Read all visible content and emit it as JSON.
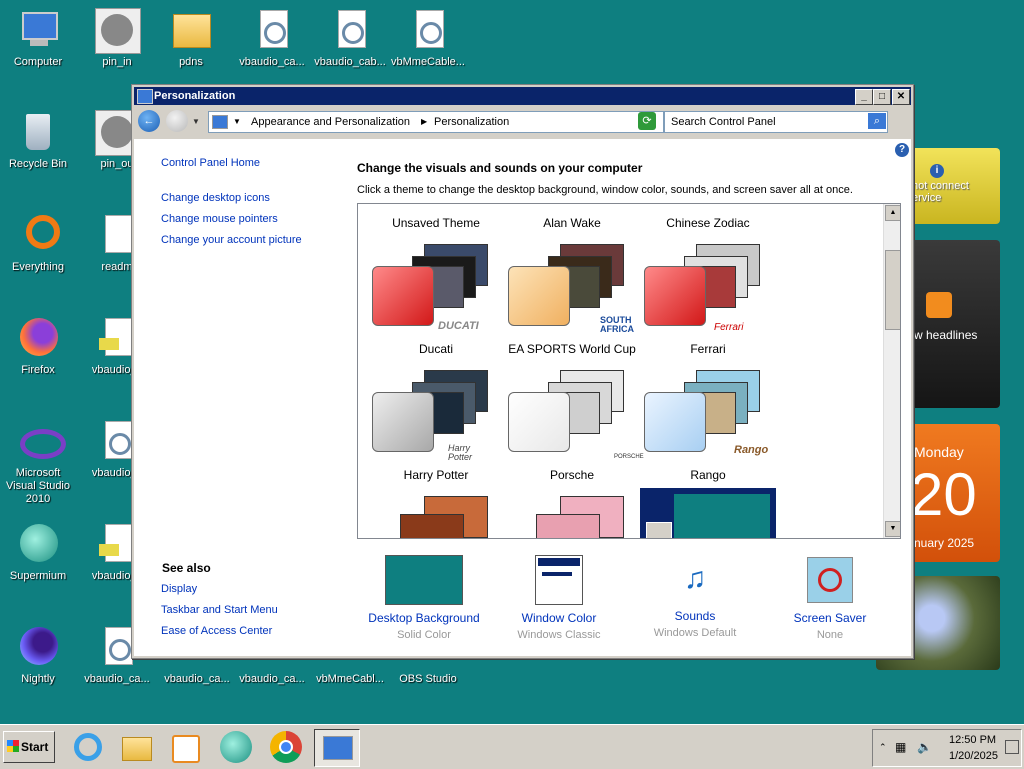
{
  "desktop_icons": [
    {
      "label": "Computer",
      "icon": "computer-icon"
    },
    {
      "label": "pin_in",
      "icon": "film-reel-icon"
    },
    {
      "label": "pdns",
      "icon": "folder-icon"
    },
    {
      "label": "vbaudio_ca...",
      "icon": "config-file-icon"
    },
    {
      "label": "vbaudio_cab...",
      "icon": "config-file-icon"
    },
    {
      "label": "vbMmeCable...",
      "icon": "config-file-icon"
    },
    {
      "label": "Recycle Bin",
      "icon": "recycle-bin-icon"
    },
    {
      "label": "pin_ou",
      "icon": "film-reel-icon"
    },
    {
      "label": "Everything",
      "icon": "everything-search-icon"
    },
    {
      "label": "readm",
      "icon": "text-file-icon"
    },
    {
      "label": "Firefox",
      "icon": "firefox-icon"
    },
    {
      "label": "vbaudio_c",
      "icon": "setup-file-icon"
    },
    {
      "label": "Microsoft Visual Studio 2010",
      "icon": "visual-studio-icon"
    },
    {
      "label": "vbaudio_c",
      "icon": "config-file-icon"
    },
    {
      "label": "Supermium",
      "icon": "supermium-icon"
    },
    {
      "label": "vbaudio_c",
      "icon": "setup-file-icon"
    },
    {
      "label": "Nightly",
      "icon": "firefox-nightly-icon"
    },
    {
      "label": "vbaudio_ca...",
      "icon": "config-file-icon"
    },
    {
      "label": "vbaudio_ca...",
      "icon": "setup-file-icon"
    },
    {
      "label": "vbaudio_ca...",
      "icon": "config-file-icon"
    },
    {
      "label": "vbMmeCabl...",
      "icon": "config-file-icon"
    },
    {
      "label": "OBS Studio",
      "icon": "obs-icon"
    }
  ],
  "gadgets": {
    "weather_text": "not connect\nervice",
    "feed_text": "w headlines",
    "calendar": {
      "weekday": "Monday",
      "day": "20",
      "month_year": "nuary 2025"
    }
  },
  "window": {
    "title": "Personalization",
    "address": [
      "Appearance and Personalization",
      "Personalization"
    ],
    "search_placeholder": "Search Control Panel",
    "left_links": [
      "Control Panel Home",
      "Change desktop icons",
      "Change mouse pointers",
      "Change your account picture"
    ],
    "see_also_title": "See also",
    "see_also": [
      "Display",
      "Taskbar and Start Menu",
      "Ease of Access Center"
    ],
    "heading": "Change the visuals and sounds on your computer",
    "subheading": "Click a theme to change the desktop background, window color, sounds, and screen saver all at once.",
    "theme_top_labels": [
      "Unsaved Theme",
      "Alan Wake",
      "Chinese Zodiac"
    ],
    "themes": [
      {
        "name": "Ducati",
        "brand": "DUCATI",
        "swatch": "#e02a2a"
      },
      {
        "name": "EA SPORTS World Cup",
        "brand": "SOUTH AFRICA",
        "swatch": "#f3c27a"
      },
      {
        "name": "Ferrari",
        "brand": "Ferrari",
        "swatch": "#e02a2a"
      },
      {
        "name": "Harry Potter",
        "brand": "Harry Potter",
        "swatch": "#c8c8c8"
      },
      {
        "name": "Porsche",
        "brand": "PORSCHE",
        "swatch": "#ffffff"
      },
      {
        "name": "Rango",
        "brand": "Rango",
        "swatch": "#cfe3f7"
      }
    ],
    "bottom": [
      {
        "name": "Desktop Background",
        "value": "Solid Color"
      },
      {
        "name": "Window Color",
        "value": "Windows Classic"
      },
      {
        "name": "Sounds",
        "value": "Windows Default"
      },
      {
        "name": "Screen Saver",
        "value": "None"
      }
    ]
  },
  "taskbar": {
    "start_label": "Start",
    "time": "12:50 PM",
    "date": "1/20/2025"
  },
  "colors": {
    "desktop": "#0e7f80",
    "titlebar": "#0a246a",
    "link": "#0033bb"
  }
}
